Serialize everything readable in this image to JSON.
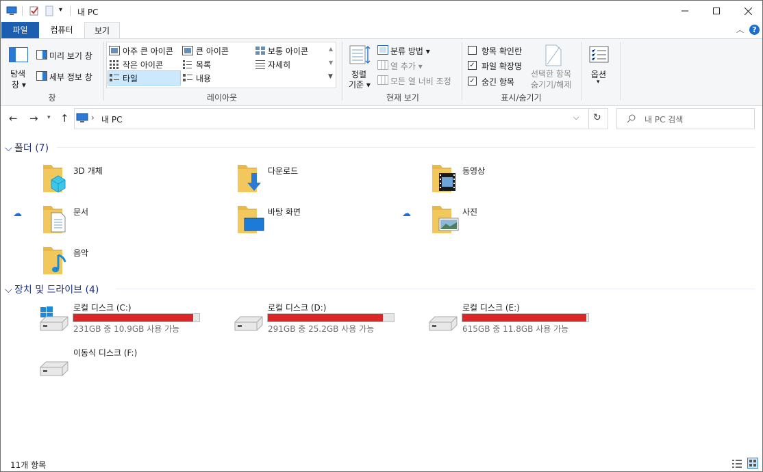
{
  "window": {
    "title": "내 PC"
  },
  "tabs": {
    "file": "파일",
    "computer": "컴퓨터",
    "view": "보기"
  },
  "ribbon": {
    "pane": {
      "nav_pane_line1": "탐색",
      "nav_pane_line2": "창",
      "preview": "미리 보기 창",
      "details": "세부 정보 창",
      "group": "창"
    },
    "layout": {
      "items": [
        "아주 큰 아이콘",
        "큰 아이콘",
        "보통 아이콘",
        "작은 아이콘",
        "목록",
        "자세히",
        "타일",
        "내용"
      ],
      "selected": "타일",
      "group": "레이아웃"
    },
    "current_view": {
      "sort_line1": "정렬",
      "sort_line2": "기준",
      "group_by": "분류 방법",
      "add_columns": "열 추가",
      "fit_columns": "모든 열 너비 조정",
      "group": "현재 보기"
    },
    "show_hide": {
      "item_checkboxes": "항목 확인란",
      "extensions": "파일 확장명",
      "hidden_items": "숨긴 항목",
      "item_checkboxes_checked": false,
      "extensions_checked": true,
      "hidden_items_checked": true,
      "hide_selected_line1": "선택한 항목",
      "hide_selected_line2": "숨기기/해제",
      "group": "표시/숨기기"
    },
    "options": {
      "label": "옵션"
    }
  },
  "address": {
    "path": "내 PC",
    "search_placeholder": "내 PC 검색"
  },
  "sections": {
    "folders": {
      "title": "폴더 (7)"
    },
    "drives": {
      "title": "장치 및 드라이브 (4)"
    }
  },
  "folders": [
    {
      "name": "3D 개체",
      "icon": "3d-objects-icon",
      "cloud": false
    },
    {
      "name": "다운로드",
      "icon": "downloads-icon",
      "cloud": false
    },
    {
      "name": "동영상",
      "icon": "videos-icon",
      "cloud": false
    },
    {
      "name": "문서",
      "icon": "documents-icon",
      "cloud": true
    },
    {
      "name": "바탕 화면",
      "icon": "desktop-icon",
      "cloud": false
    },
    {
      "name": "사진",
      "icon": "pictures-icon",
      "cloud": true
    },
    {
      "name": "음악",
      "icon": "music-icon",
      "cloud": false
    }
  ],
  "drives": [
    {
      "name": "로컬 디스크 (C:)",
      "free": "231GB 중 10.9GB 사용 가능",
      "used_fraction": 0.953
    },
    {
      "name": "로컬 디스크 (D:)",
      "free": "291GB 중 25.2GB 사용 가능",
      "used_fraction": 0.913
    },
    {
      "name": "로컬 디스크 (E:)",
      "free": "615GB 중 11.8GB 사용 가능",
      "used_fraction": 0.981
    },
    {
      "name": "이동식 디스크 (F:)",
      "free": "",
      "used_fraction": null
    }
  ],
  "status": {
    "count": "11개 항목"
  },
  "colors": {
    "accent": "#1c5fb0",
    "section_header": "#1e3287",
    "drive_bar": "#da2626",
    "folder": "#f2c75c"
  }
}
